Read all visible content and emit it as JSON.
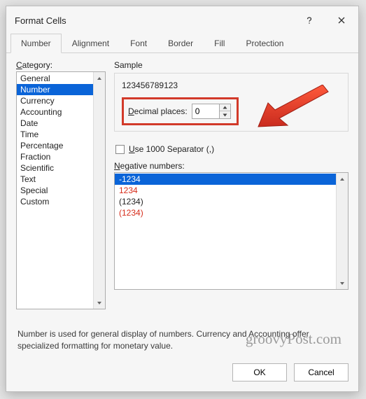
{
  "dialog": {
    "title": "Format Cells"
  },
  "tabs": {
    "items": [
      {
        "label": "Number",
        "active": true
      },
      {
        "label": "Alignment"
      },
      {
        "label": "Font"
      },
      {
        "label": "Border"
      },
      {
        "label": "Fill"
      },
      {
        "label": "Protection"
      }
    ]
  },
  "category": {
    "label": "Category:",
    "items": [
      "General",
      "Number",
      "Currency",
      "Accounting",
      "Date",
      "Time",
      "Percentage",
      "Fraction",
      "Scientific",
      "Text",
      "Special",
      "Custom"
    ],
    "selected": "Number"
  },
  "sample": {
    "label": "Sample",
    "value": "123456789123"
  },
  "decimal": {
    "label_pre": "D",
    "label_post": "ecimal places:",
    "value": "0"
  },
  "separator": {
    "label_pre": "U",
    "label_post": "se 1000 Separator (,)",
    "checked": false
  },
  "negative": {
    "label_pre": "N",
    "label_post": "egative numbers:",
    "items": [
      {
        "text": "-1234",
        "style": "selected"
      },
      {
        "text": "1234",
        "style": "red"
      },
      {
        "text": "(1234)",
        "style": ""
      },
      {
        "text": "(1234)",
        "style": "red"
      }
    ]
  },
  "description": "Number is used for general display of numbers.  Currency and Accounting offer specialized formatting for monetary value.",
  "buttons": {
    "ok": "OK",
    "cancel": "Cancel"
  },
  "watermark": "groovyPost.com"
}
